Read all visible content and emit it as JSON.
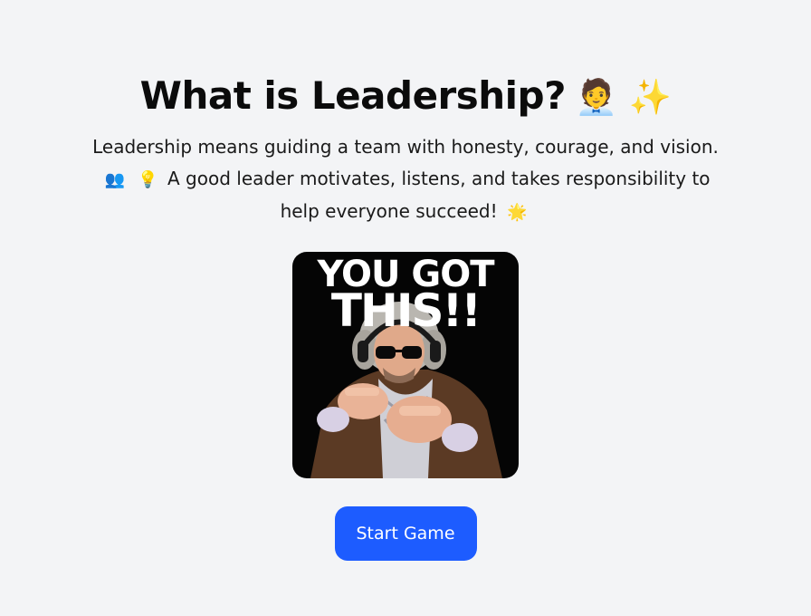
{
  "header": {
    "title": "What is Leadership?",
    "title_emojis": "🧑‍💼 ✨"
  },
  "intro": {
    "line1": "Leadership means guiding a team with honesty, courage, and vision.",
    "emoji_team": "👥",
    "emoji_bulb": "💡",
    "line2": "A good leader motivates, listens, and takes responsibility to help everyone succeed!",
    "emoji_sun": "🌟"
  },
  "image": {
    "caption_line1": "YOU GOT",
    "caption_line2": "THIS!!"
  },
  "actions": {
    "start_label": "Start Game"
  },
  "colors": {
    "background": "#f3f4f6",
    "button": "#1d5cff",
    "button_text": "#ffffff"
  }
}
